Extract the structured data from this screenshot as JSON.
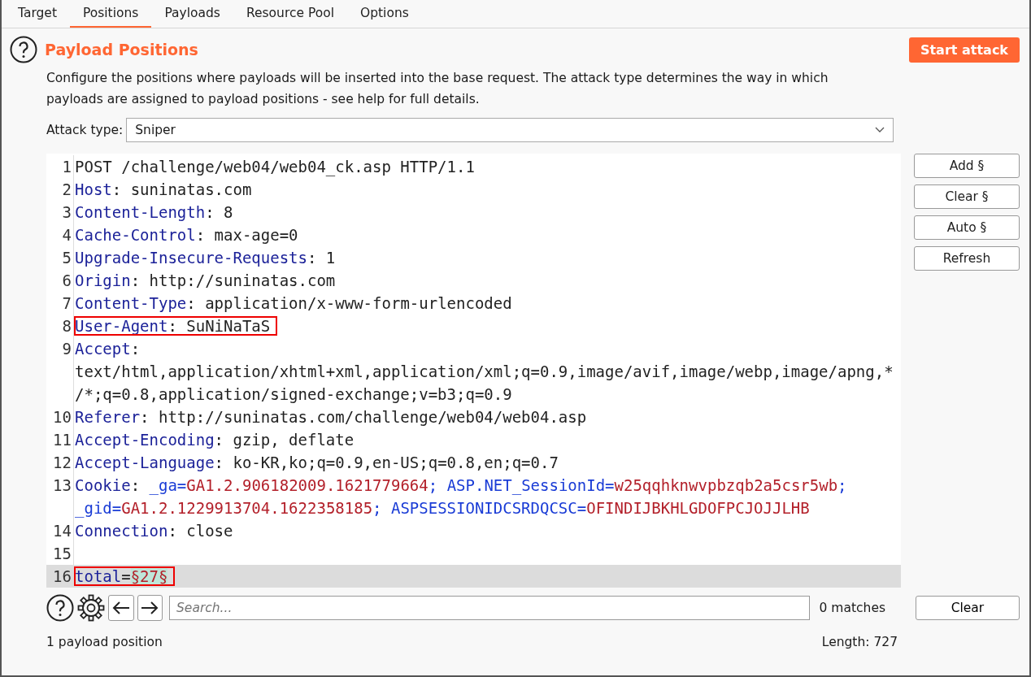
{
  "tabs": [
    {
      "label": "Target",
      "selected": false
    },
    {
      "label": "Positions",
      "selected": true
    },
    {
      "label": "Payloads",
      "selected": false
    },
    {
      "label": "Resource Pool",
      "selected": false
    },
    {
      "label": "Options",
      "selected": false
    }
  ],
  "section": {
    "title": "Payload Positions",
    "description": "Configure the positions where payloads will be inserted into the base request. The attack type determines the way in which payloads are assigned to payload positions - see help for full details.",
    "start_button": "Start attack"
  },
  "attack_type": {
    "label": "Attack type:",
    "value": "Sniper"
  },
  "editor": {
    "lines": [
      {
        "number": "1",
        "boxed": false,
        "current": false,
        "segments": [
          {
            "kind": "plain",
            "text": "POST /challenge/web04/web04_ck.asp HTTP/1.1"
          }
        ]
      },
      {
        "number": "2",
        "boxed": false,
        "current": false,
        "segments": [
          {
            "kind": "header",
            "text": "Host"
          },
          {
            "kind": "plain",
            "text": ": suninatas.com"
          }
        ]
      },
      {
        "number": "3",
        "boxed": false,
        "current": false,
        "segments": [
          {
            "kind": "header",
            "text": "Content-Length"
          },
          {
            "kind": "plain",
            "text": ": 8"
          }
        ]
      },
      {
        "number": "4",
        "boxed": false,
        "current": false,
        "segments": [
          {
            "kind": "header",
            "text": "Cache-Control"
          },
          {
            "kind": "plain",
            "text": ": max-age=0"
          }
        ]
      },
      {
        "number": "5",
        "boxed": false,
        "current": false,
        "segments": [
          {
            "kind": "header",
            "text": "Upgrade-Insecure-Requests"
          },
          {
            "kind": "plain",
            "text": ": 1"
          }
        ]
      },
      {
        "number": "6",
        "boxed": false,
        "current": false,
        "segments": [
          {
            "kind": "header",
            "text": "Origin"
          },
          {
            "kind": "plain",
            "text": ": http://suninatas.com"
          }
        ]
      },
      {
        "number": "7",
        "boxed": false,
        "current": false,
        "segments": [
          {
            "kind": "header",
            "text": "Content-Type"
          },
          {
            "kind": "plain",
            "text": ": application/x-www-form-urlencoded"
          }
        ]
      },
      {
        "number": "8",
        "boxed": true,
        "current": false,
        "segments": [
          {
            "kind": "header",
            "text": "User-Agent"
          },
          {
            "kind": "plain",
            "text": ": SuNiNaTaS"
          }
        ]
      },
      {
        "number": "9",
        "boxed": false,
        "current": false,
        "segments": [
          {
            "kind": "header",
            "text": "Accept"
          },
          {
            "kind": "plain",
            "text": ": text/html,application/xhtml+xml,application/xml;q=0.9,image/avif,image/webp,image/apng,*/*;q=0.8,application/signed-exchange;v=b3;q=0.9"
          }
        ]
      },
      {
        "number": "10",
        "boxed": false,
        "current": false,
        "segments": [
          {
            "kind": "header",
            "text": "Referer"
          },
          {
            "kind": "plain",
            "text": ": http://suninatas.com/challenge/web04/web04.asp"
          }
        ]
      },
      {
        "number": "11",
        "boxed": false,
        "current": false,
        "segments": [
          {
            "kind": "header",
            "text": "Accept-Encoding"
          },
          {
            "kind": "plain",
            "text": ": gzip, deflate"
          }
        ]
      },
      {
        "number": "12",
        "boxed": false,
        "current": false,
        "segments": [
          {
            "kind": "header",
            "text": "Accept-Language"
          },
          {
            "kind": "plain",
            "text": ": ko-KR,ko;q=0.9,en-US;q=0.8,en;q=0.7"
          }
        ]
      },
      {
        "number": "13",
        "boxed": false,
        "current": false,
        "segments": [
          {
            "kind": "header",
            "text": "Cookie"
          },
          {
            "kind": "plain",
            "text": ": "
          },
          {
            "kind": "param-name",
            "text": "_ga"
          },
          {
            "kind": "param-sep",
            "text": "="
          },
          {
            "kind": "param-value",
            "text": "GA1.2.906182009.1621779664"
          },
          {
            "kind": "param-sep",
            "text": "; "
          },
          {
            "kind": "param-name",
            "text": "ASP.NET_SessionId"
          },
          {
            "kind": "param-sep",
            "text": "="
          },
          {
            "kind": "param-value",
            "text": "w25qqhknwvpbzqb2a5csr5wb"
          },
          {
            "kind": "param-sep",
            "text": "; "
          },
          {
            "kind": "param-name",
            "text": "_gid"
          },
          {
            "kind": "param-sep",
            "text": "="
          },
          {
            "kind": "param-value",
            "text": "GA1.2.1229913704.1622358185"
          },
          {
            "kind": "param-sep",
            "text": "; "
          },
          {
            "kind": "param-name",
            "text": "ASPSESSIONIDCSRDQCSC"
          },
          {
            "kind": "param-sep",
            "text": "="
          },
          {
            "kind": "param-value",
            "text": "OFINDIJBKHLGDOFPCJOJJLHB"
          }
        ]
      },
      {
        "number": "14",
        "boxed": false,
        "current": false,
        "segments": [
          {
            "kind": "header",
            "text": "Connection"
          },
          {
            "kind": "plain",
            "text": ": close"
          }
        ]
      },
      {
        "number": "15",
        "boxed": false,
        "current": false
      },
      {
        "number": "16",
        "boxed": true,
        "current": true,
        "segments": [
          {
            "kind": "header",
            "text": "total"
          },
          {
            "kind": "plain",
            "text": "="
          },
          {
            "kind": "payload",
            "text": "§27§"
          }
        ]
      }
    ]
  },
  "side_buttons": [
    "Add §",
    "Clear §",
    "Auto §",
    "Refresh"
  ],
  "search": {
    "placeholder": "Search...",
    "matches": "0 matches",
    "clear": "Clear"
  },
  "status": {
    "positions": "1 payload position",
    "length": "Length: 727"
  }
}
